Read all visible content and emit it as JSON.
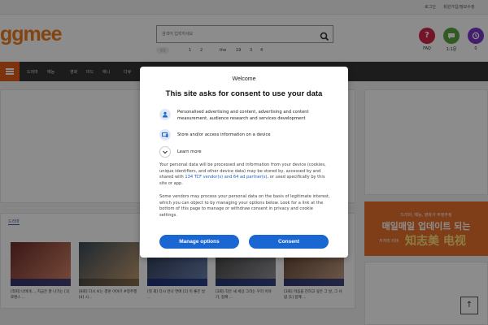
{
  "topbar": {
    "login": "로그인",
    "signup": "회원가입/정보수정"
  },
  "header": {
    "logo": "ggmee",
    "search_placeholder": "검색어 입력하세요",
    "rank_tag": "실검",
    "ranks": [
      "1",
      "2",
      "the",
      "19",
      "3",
      "4"
    ],
    "icons": [
      {
        "icon": "question-icon",
        "label": "FAQ",
        "color": "#d3264a"
      },
      {
        "icon": "chat-icon",
        "label": "1:1문",
        "color": "#5aa63f"
      },
      {
        "icon": "history-icon",
        "label": "0",
        "color": "#7b35c8"
      }
    ]
  },
  "nav": {
    "items": [
      "드라마",
      "예능",
      "영화",
      "미드",
      "애니",
      "다큐"
    ]
  },
  "section": {
    "title": "드라마"
  },
  "thumbs": [
    {
      "caption": "[첫회] 너에게..., 지금은 잘 나가는 [1] 로맨스 ...",
      "colors": [
        "#6b2a2a",
        "#d98a6a"
      ]
    },
    {
      "caption": "[8회] 다시 보는 결혼 이야기 #정주행 [4] 시...",
      "colors": [
        "#3a4a5a",
        "#c9a070"
      ]
    },
    {
      "caption": "[첫 회] 다시 만나 연애 [1] 이 좋은 날 ...",
      "colors": [
        "#2b3550",
        "#6f86b5"
      ]
    },
    {
      "caption": "[3회] 작은 새 세상 그리는 우리 이야기, 함께 ...",
      "colors": [
        "#3b3b3b",
        "#9a9aa0"
      ]
    },
    {
      "caption": "[3회] 마음을 전하고 싶은 그 날, 그 사람 [1] 함께 ...",
      "colors": [
        "#5a3b2c",
        "#caa58a"
      ]
    }
  ],
  "banner": {
    "line1": "드라마, 예능, 영화가 주정주정",
    "line2": "매일매일 업데이트 되는",
    "line3": "지지미 티비",
    "line4": "知志美 电视"
  },
  "consent": {
    "welcome": "Welcome",
    "title": "This site asks for consent to use your data",
    "item1": "Personalised advertising and content, advertising and content measurement, audience research and services development",
    "item2": "Store and/or access information on a device",
    "learn_more": "Learn more",
    "para1_pre": "Your personal data will be processed and information from your device (cookies, unique identifiers, and other device data) may be stored by, accessed by and shared with ",
    "para1_link": "134 TCF vendor(s) and 64 ad partner(s)",
    "para1_post": ", or used specifically by this site or app.",
    "para2": "Some vendors may process your personal data on the basis of legitimate interest, which you can object to by managing your options below. Look for a link at the bottom of this page to manage or withdraw consent in privacy and cookie settings.",
    "manage": "Manage options",
    "consent_btn": "Consent"
  },
  "colors": {
    "brand": "#f07c1c",
    "button": "#1a66d2",
    "nav": "#333333"
  }
}
